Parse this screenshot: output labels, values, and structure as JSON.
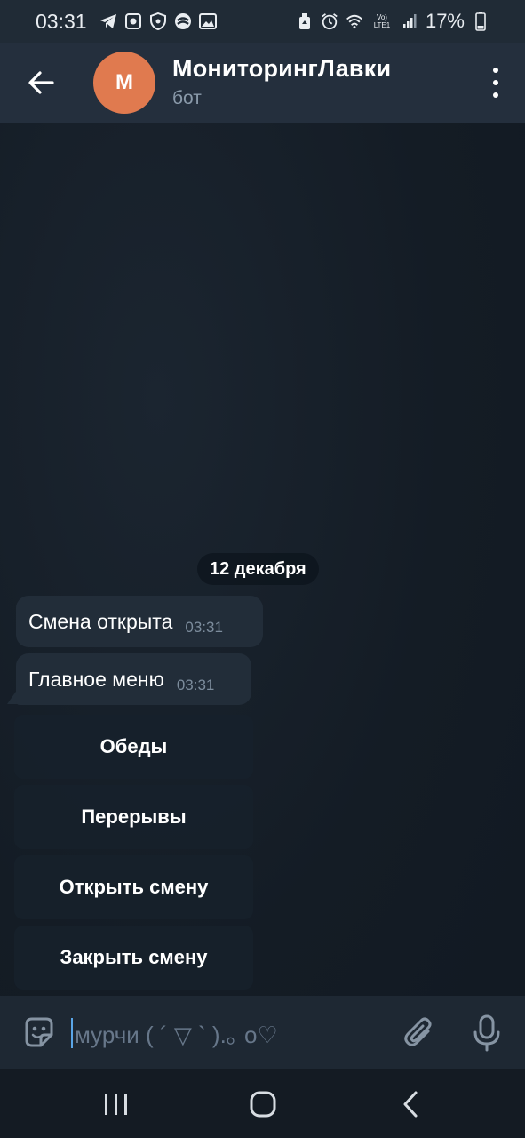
{
  "status_bar": {
    "time": "03:31",
    "battery": "17%",
    "icons": [
      "telegram-icon",
      "notification-icon",
      "shield-icon",
      "app-icon",
      "gallery-icon",
      "recycle-icon",
      "alarm-icon",
      "wifi-icon",
      "volte-icon",
      "signal-icon",
      "battery-icon"
    ],
    "volte_label": "Vo) LTE1"
  },
  "header": {
    "avatar_letter": "М",
    "avatar_color": "#e07a4f",
    "title": "МониторингЛавки",
    "subtitle": "бот"
  },
  "chat": {
    "date": "12 декабря",
    "messages": [
      {
        "text": "Смена открыта",
        "time": "03:31"
      },
      {
        "text": "Главное меню",
        "time": "03:31"
      }
    ],
    "keyboard": [
      "Обеды",
      "Перерывы",
      "Открыть смену",
      "Закрыть смену"
    ]
  },
  "input": {
    "placeholder": "мурчи ( ´ ▽ ` ).｡ o♡"
  },
  "colors": {
    "accent": "#5aa6e8",
    "header_bg": "#242f3d",
    "bubble_bg": "#222d39"
  }
}
